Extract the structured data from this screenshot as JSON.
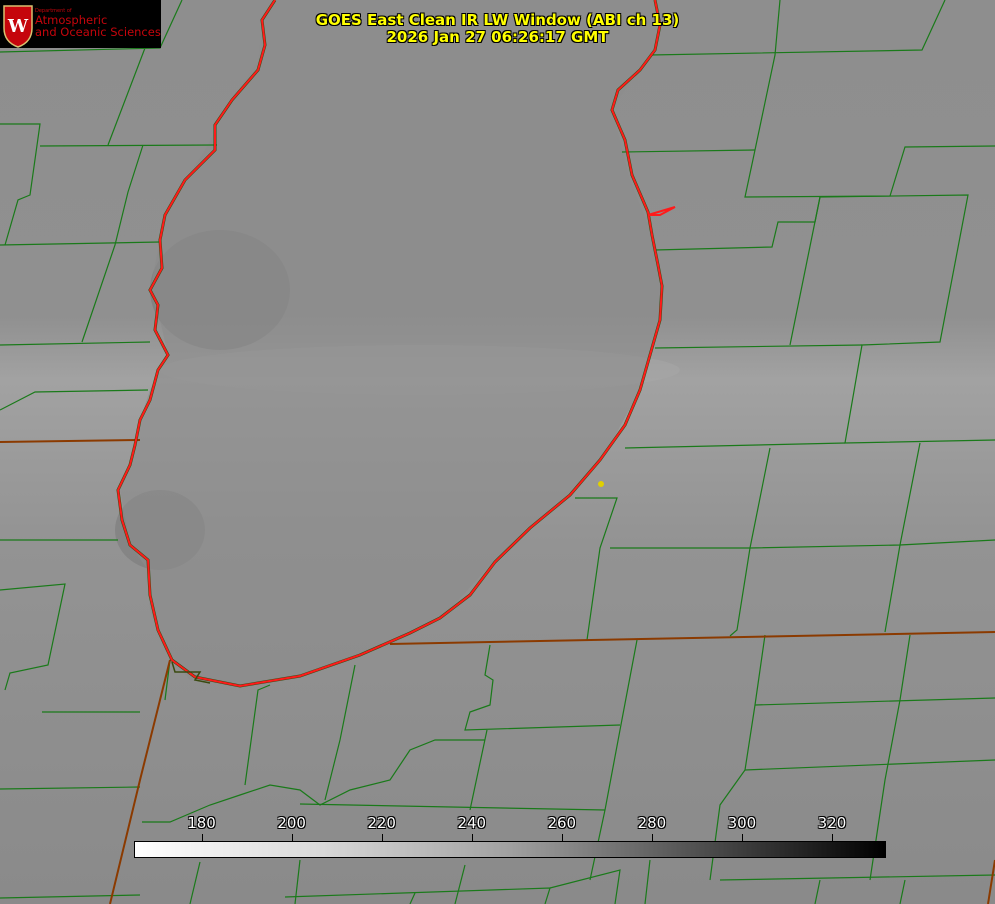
{
  "title": {
    "line1": "GOES East Clean IR LW Window (ABI ch 13)",
    "line2": "2026 Jan 27 06:26:17 GMT"
  },
  "logo": {
    "dept": "Department of",
    "line1": "Atmospheric",
    "line2": "and Oceanic Sciences",
    "emblem_letter": "W"
  },
  "colorbar": {
    "ticks": [
      "180",
      "200",
      "220",
      "240",
      "260",
      "280",
      "300",
      "320"
    ],
    "range_low": 165,
    "range_high": 332
  },
  "colors": {
    "county_lines": "#1a7a1a",
    "state_lines": "#8b3a00",
    "lake_outline": "#ff0000",
    "title_text": "#ffff00",
    "logo_red": "#c5050c",
    "station_marker": "#e0d000"
  }
}
